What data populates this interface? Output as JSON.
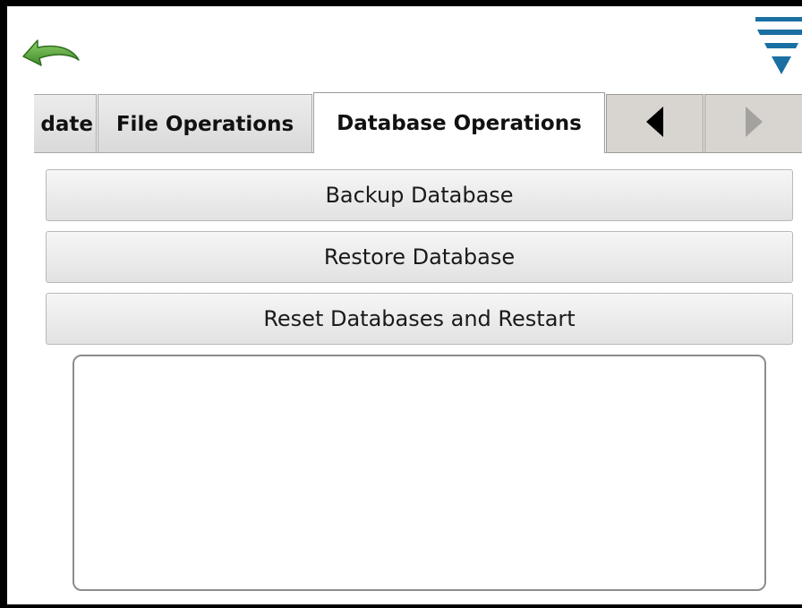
{
  "toolbar": {
    "back_icon": "back-arrow-icon",
    "menu_icon": "menu-dropdown-icon",
    "accent_color": "#1a6fa3",
    "back_color": "#5aa83c"
  },
  "tabs": [
    {
      "label": "date",
      "active": false
    },
    {
      "label": "File Operations",
      "active": false
    },
    {
      "label": "Database Operations",
      "active": true
    }
  ],
  "tab_nav": {
    "prev_icon": "triangle-left-icon",
    "next_icon": "triangle-right-icon",
    "next_disabled": true
  },
  "actions": {
    "backup_label": "Backup Database",
    "restore_label": "Restore Database",
    "reset_label": "Reset Databases and Restart"
  },
  "output": {
    "text": ""
  }
}
